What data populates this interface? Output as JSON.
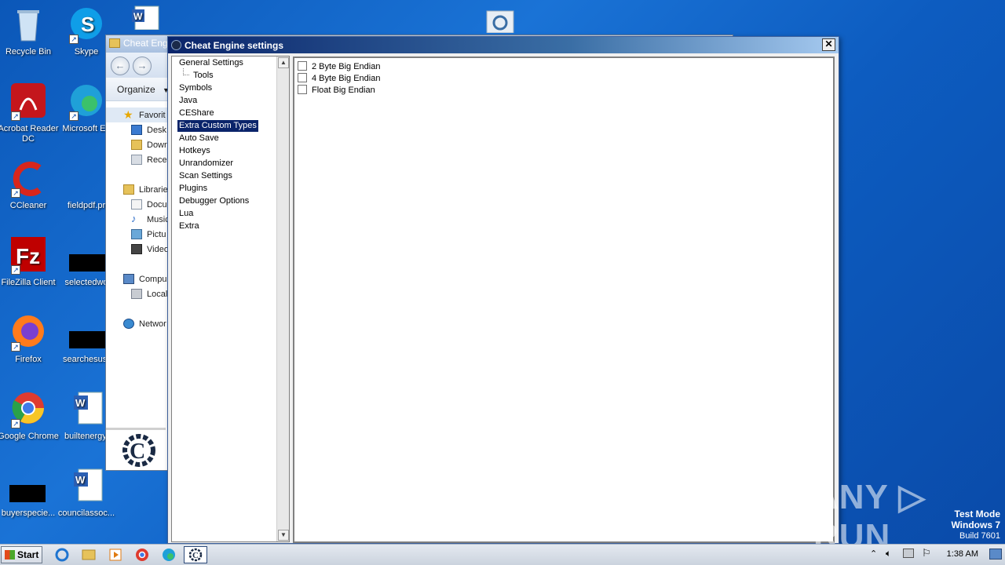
{
  "desktop": {
    "icons": [
      {
        "label": "Recycle Bin"
      },
      {
        "label": "Skype"
      },
      {
        "label": "Acrobat Reader DC"
      },
      {
        "label": "Microsoft Ed"
      },
      {
        "label": "CCleaner"
      },
      {
        "label": "fieldpdf.pr"
      },
      {
        "label": "FileZilla Client"
      },
      {
        "label": "selectedwo"
      },
      {
        "label": "Firefox"
      },
      {
        "label": "searchesusr"
      },
      {
        "label": "Google Chrome"
      },
      {
        "label": "builtenergy."
      },
      {
        "label": "buyerspecie..."
      },
      {
        "label": "councilassoc..."
      }
    ]
  },
  "explorer": {
    "title": "Cheat Eng",
    "organize_label": "Organize",
    "sidebar": [
      {
        "label": "Favorit",
        "icon": "star-icon"
      },
      {
        "label": "Desk",
        "icon": "desktop-icon"
      },
      {
        "label": "Dowr",
        "icon": "downloads-icon"
      },
      {
        "label": "Rece",
        "icon": "recent-icon"
      },
      {
        "label": "Librarie",
        "icon": "libraries-icon"
      },
      {
        "label": "Docu",
        "icon": "documents-icon"
      },
      {
        "label": "Music",
        "icon": "music-icon"
      },
      {
        "label": "Pictu",
        "icon": "pictures-icon"
      },
      {
        "label": "Video",
        "icon": "videos-icon"
      },
      {
        "label": "Compu",
        "icon": "computer-icon"
      },
      {
        "label": "Local",
        "icon": "local-disk-icon"
      },
      {
        "label": "Networ",
        "icon": "network-icon"
      }
    ]
  },
  "dialog": {
    "title": "Cheat Engine settings",
    "close_label": "✕",
    "tree": [
      {
        "label": "General Settings"
      },
      {
        "label": "Tools"
      },
      {
        "label": "Symbols"
      },
      {
        "label": "Java"
      },
      {
        "label": "CEShare"
      },
      {
        "label": "Extra Custom Types"
      },
      {
        "label": "Auto Save"
      },
      {
        "label": "Hotkeys"
      },
      {
        "label": "Unrandomizer"
      },
      {
        "label": "Scan Settings"
      },
      {
        "label": "Plugins"
      },
      {
        "label": "Debugger Options"
      },
      {
        "label": "Lua"
      },
      {
        "label": "Extra"
      }
    ],
    "selected_item": "Extra Custom Types",
    "options": [
      {
        "label": "2 Byte Big Endian",
        "checked": false
      },
      {
        "label": "4 Byte Big Endian",
        "checked": false
      },
      {
        "label": "Float Big Endian",
        "checked": false
      }
    ]
  },
  "taskbar": {
    "start_label": "Start",
    "clock": "1:38 AM"
  },
  "overlay": {
    "watermark": "ANY ▷ RUN",
    "test_mode": "Test Mode",
    "os_name": "Windows 7",
    "build": "Build 7601"
  },
  "colors": {
    "selection": "#0a246a",
    "desktop_blue": "#1a73d6"
  }
}
